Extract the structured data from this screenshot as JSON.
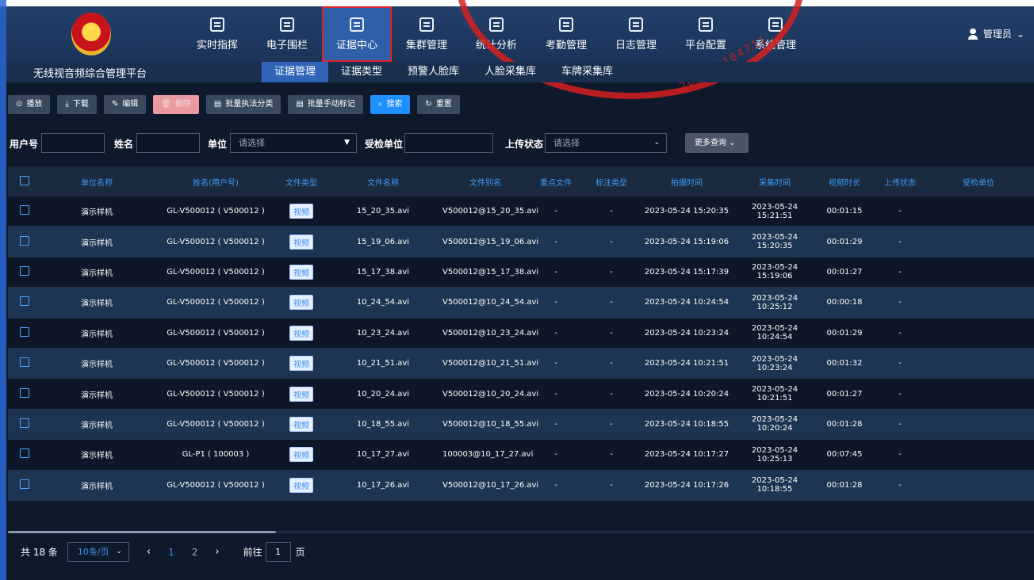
{
  "app": {
    "platform_title": "无线视音频综合管理平台",
    "user_label": "管理员"
  },
  "nav": [
    {
      "label": "实时指挥",
      "icon": "map-icon"
    },
    {
      "label": "电子围栏",
      "icon": "fence-icon"
    },
    {
      "label": "证据中心",
      "icon": "evidence-icon",
      "active": true
    },
    {
      "label": "集群管理",
      "icon": "cluster-icon"
    },
    {
      "label": "统计分析",
      "icon": "chart-icon"
    },
    {
      "label": "考勤管理",
      "icon": "calendar-icon"
    },
    {
      "label": "日志管理",
      "icon": "log-icon"
    },
    {
      "label": "平台配置",
      "icon": "config-icon"
    },
    {
      "label": "系统管理",
      "icon": "system-icon"
    }
  ],
  "subtabs": [
    "证据管理",
    "证据类型",
    "预警人脸库",
    "人脸采集库",
    "车牌采集库"
  ],
  "toolbar": {
    "play": "播放",
    "download": "下载",
    "edit": "编辑",
    "delete": "删除",
    "batch_classify": "批量执法分类",
    "batch_mark": "批量手动标记",
    "search": "搜索",
    "reset": "重置"
  },
  "filters": {
    "user_no_label": "用户号",
    "name_label": "姓名",
    "unit_label": "单位",
    "unit_placeholder": "请选择",
    "inspected_unit_label": "受检单位",
    "upload_status_label": "上传状态",
    "upload_status_placeholder": "请选择",
    "more_query": "更多查询"
  },
  "table": {
    "headers": [
      "单位名称",
      "姓名(用户号)",
      "文件类型",
      "文件名称",
      "文件别名",
      "重点文件",
      "标注类型",
      "拍摄时间",
      "采集时间",
      "视频时长",
      "上传状态",
      "受检单位"
    ],
    "rows": [
      [
        "演示样机",
        "GL-V500012 ( V500012 )",
        "视频",
        "15_20_35.avi",
        "V500012@15_20_35.avi",
        "-",
        "-",
        "2023-05-24 15:20:35",
        "2023-05-24 15:21:51",
        "00:01:15",
        "-",
        ""
      ],
      [
        "演示样机",
        "GL-V500012 ( V500012 )",
        "视频",
        "15_19_06.avi",
        "V500012@15_19_06.avi",
        "-",
        "-",
        "2023-05-24 15:19:06",
        "2023-05-24 15:20:35",
        "00:01:29",
        "-",
        ""
      ],
      [
        "演示样机",
        "GL-V500012 ( V500012 )",
        "视频",
        "15_17_38.avi",
        "V500012@15_17_38.avi",
        "-",
        "-",
        "2023-05-24 15:17:39",
        "2023-05-24 15:19:06",
        "00:01:27",
        "-",
        ""
      ],
      [
        "演示样机",
        "GL-V500012 ( V500012 )",
        "视频",
        "10_24_54.avi",
        "V500012@10_24_54.avi",
        "-",
        "-",
        "2023-05-24 10:24:54",
        "2023-05-24 10:25:12",
        "00:00:18",
        "-",
        ""
      ],
      [
        "演示样机",
        "GL-V500012 ( V500012 )",
        "视频",
        "10_23_24.avi",
        "V500012@10_23_24.avi",
        "-",
        "-",
        "2023-05-24 10:23:24",
        "2023-05-24 10:24:54",
        "00:01:29",
        "-",
        ""
      ],
      [
        "演示样机",
        "GL-V500012 ( V500012 )",
        "视频",
        "10_21_51.avi",
        "V500012@10_21_51.avi",
        "-",
        "-",
        "2023-05-24 10:21:51",
        "2023-05-24 10:23:24",
        "00:01:32",
        "-",
        ""
      ],
      [
        "演示样机",
        "GL-V500012 ( V500012 )",
        "视频",
        "10_20_24.avi",
        "V500012@10_20_24.avi",
        "-",
        "-",
        "2023-05-24 10:20:24",
        "2023-05-24 10:21:51",
        "00:01:27",
        "-",
        ""
      ],
      [
        "演示样机",
        "GL-V500012 ( V500012 )",
        "视频",
        "10_18_55.avi",
        "V500012@10_18_55.avi",
        "-",
        "-",
        "2023-05-24 10:18:55",
        "2023-05-24 10:20:24",
        "00:01:28",
        "-",
        ""
      ],
      [
        "演示样机",
        "GL-P1 ( 100003 )",
        "视频",
        "10_17_27.avi",
        "100003@10_17_27.avi",
        "-",
        "-",
        "2023-05-24 10:17:27",
        "2023-05-24 10:25:13",
        "00:07:45",
        "-",
        ""
      ],
      [
        "演示样机",
        "GL-V500012 ( V500012 )",
        "视频",
        "10_17_26.avi",
        "V500012@10_17_26.avi",
        "-",
        "-",
        "2023-05-24 10:17:26",
        "2023-05-24 10:18:55",
        "00:01:28",
        "-",
        ""
      ]
    ]
  },
  "pagination": {
    "total": "共 18 条",
    "page_size": "10条/页",
    "prev": "‹",
    "pages": [
      "1",
      "2"
    ],
    "next": "›",
    "goto_label": "前往",
    "goto_value": "1",
    "goto_suffix": "页"
  },
  "watermark": {
    "stamp_digits": "201051104711"
  },
  "colors": {
    "active_border": "#e0232a",
    "accent": "#1e8fff",
    "header_bg": "#23406b"
  }
}
